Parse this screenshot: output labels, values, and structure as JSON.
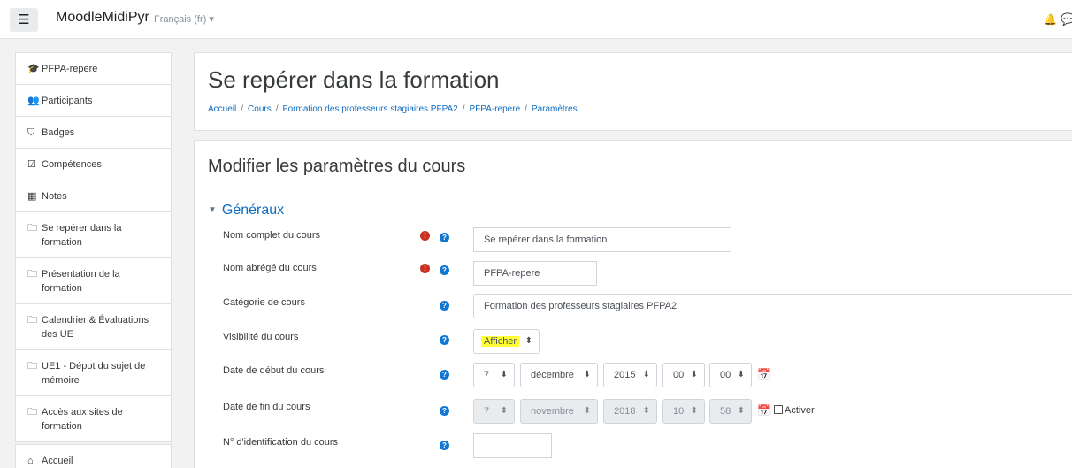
{
  "navbar": {
    "menu_icon": "☰",
    "brand": "MoodleMidiPyr",
    "language": "Français (fr) ▾",
    "bell_icon": "🔔",
    "chat_icon": "💬"
  },
  "sidebar": {
    "items": [
      {
        "icon": "graduation-cap-icon",
        "glyph": "🎓",
        "label": "PFPA-repere"
      },
      {
        "icon": "users-icon",
        "glyph": "👥",
        "label": "Participants"
      },
      {
        "icon": "shield-icon",
        "glyph": "⛉",
        "label": "Badges"
      },
      {
        "icon": "check-square-icon",
        "glyph": "☑",
        "label": "Compétences"
      },
      {
        "icon": "table-icon",
        "glyph": "▦",
        "label": "Notes"
      },
      {
        "icon": "folder-icon",
        "glyph": "🗀",
        "label": "Se repérer dans la formation"
      },
      {
        "icon": "folder-icon",
        "glyph": "🗀",
        "label": "Présentation de la formation"
      },
      {
        "icon": "folder-icon",
        "glyph": "🗀",
        "label": "Calendrier & Évaluations des UE"
      },
      {
        "icon": "folder-icon",
        "glyph": "🗀",
        "label": "UE1 - Dépot du sujet de mémoire"
      },
      {
        "icon": "folder-icon",
        "glyph": "🗀",
        "label": "Accès aux sites de formation"
      }
    ],
    "home": {
      "icon": "home-icon",
      "glyph": "⌂",
      "label": "Accueil"
    }
  },
  "header": {
    "title": "Se repérer dans la formation",
    "breadcrumb": [
      "Accueil",
      "Cours",
      "Formation des professeurs stagiaires PFPA2",
      "PFPA-repere",
      "Paramètres"
    ],
    "separator": "/"
  },
  "form": {
    "title": "Modifier les paramètres du cours",
    "section": "Généraux",
    "section_caret": "▼",
    "required_glyph": "!",
    "help_glyph": "?",
    "arrow_glyph": "⬍",
    "calendar_glyph": "📅",
    "fields": {
      "fullname": {
        "label": "Nom complet du cours",
        "value": "Se repérer dans la formation"
      },
      "shortname": {
        "label": "Nom abrégé du cours",
        "value": "PFPA-repere"
      },
      "category": {
        "label": "Catégorie de cours",
        "value": "Formation des professeurs stagiaires PFPA2"
      },
      "visibility": {
        "label": "Visibilité du cours",
        "value": "Afficher",
        "highlight_color": "#ffff33"
      },
      "startdate": {
        "label": "Date de début du cours",
        "day": "7",
        "month": "décembre",
        "year": "2015",
        "hour": "00",
        "minute": "00"
      },
      "enddate": {
        "label": "Date de fin du cours",
        "day": "7",
        "month": "novembre",
        "year": "2018",
        "hour": "10",
        "minute": "58",
        "enable_label": "Activer",
        "enabled": false
      },
      "idnumber": {
        "label": "N° d'identification du cours",
        "value": ""
      }
    }
  },
  "colors": {
    "link": "#0f6cbf",
    "required": "#ca3120",
    "help": "#1177d1"
  }
}
